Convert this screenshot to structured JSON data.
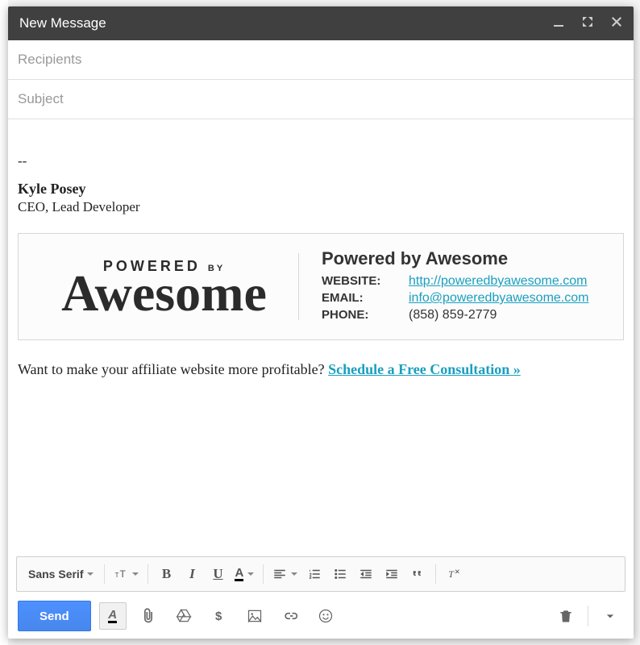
{
  "header": {
    "title": "New Message"
  },
  "fields": {
    "recipients_placeholder": "Recipients",
    "subject_placeholder": "Subject"
  },
  "signature": {
    "separator": "--",
    "name": "Kyle Posey",
    "title": "CEO, Lead Developer",
    "logo_top": "POWERED",
    "logo_by": "BY",
    "logo_script": "Awesome",
    "company": "Powered by Awesome",
    "rows": [
      {
        "label": "WEBSITE:",
        "value": "http://poweredbyawesome.com",
        "is_link": true
      },
      {
        "label": "EMAIL:",
        "value": "info@poweredbyawesome.com",
        "is_link": true
      },
      {
        "label": "PHONE:",
        "value": "(858) 859-2779",
        "is_link": false
      }
    ],
    "cta_text": "Want to make your affiliate website more profitable? ",
    "cta_link": "Schedule a Free Consultation »"
  },
  "format_toolbar": {
    "font": "Sans Serif"
  },
  "actions": {
    "send": "Send"
  },
  "icons": {
    "minimize": "minimize-icon",
    "expand": "expand-icon",
    "close": "close-icon",
    "font_size": "font-size-icon",
    "bold": "bold-icon",
    "italic": "italic-icon",
    "underline": "underline-icon",
    "text_color": "text-color-icon",
    "align": "align-icon",
    "numbered_list": "numbered-list-icon",
    "bulleted_list": "bulleted-list-icon",
    "indent_less": "indent-less-icon",
    "indent_more": "indent-more-icon",
    "quote": "quote-icon",
    "remove_format": "remove-format-icon",
    "formatting": "formatting-options-icon",
    "attach": "attach-icon",
    "drive": "drive-icon",
    "money": "money-icon",
    "photo": "photo-icon",
    "link": "link-icon",
    "emoji": "emoji-icon",
    "trash": "trash-icon",
    "more": "more-options-icon"
  }
}
